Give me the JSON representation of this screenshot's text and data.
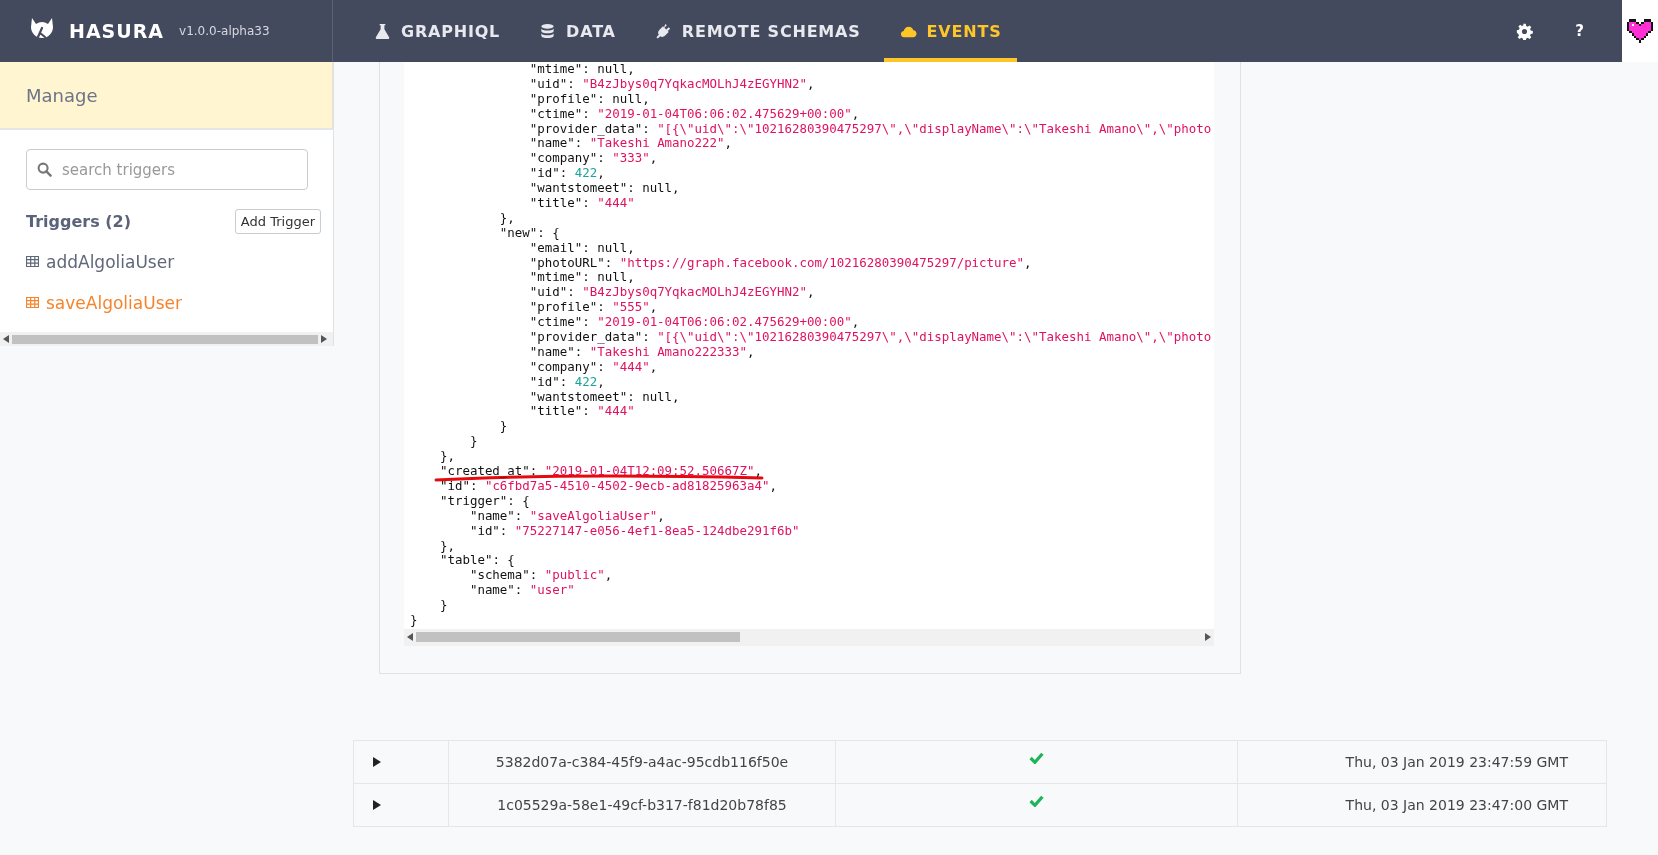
{
  "header": {
    "brand": "HASURA",
    "version": "v1.0.0-alpha33",
    "help": "?"
  },
  "tabs": [
    {
      "label": "GRAPHIQL",
      "kind": "flask",
      "selected": false
    },
    {
      "label": "DATA",
      "kind": "database",
      "selected": false
    },
    {
      "label": "REMOTE SCHEMAS",
      "kind": "plug",
      "selected": false
    },
    {
      "label": "EVENTS",
      "kind": "cloud",
      "selected": true
    }
  ],
  "sidebar": {
    "title": "Manage",
    "search": {
      "placeholder": "search triggers"
    },
    "heading": "Triggers (2)",
    "add_button": "Add Trigger",
    "items": [
      {
        "label": "addAlgoliaUser",
        "selected": false
      },
      {
        "label": "saveAlgoliaUser",
        "selected": true
      }
    ]
  },
  "payload": {
    "lines": [
      {
        "text": "                \"mtime\": null,",
        "underlined": false
      },
      {
        "text": "                \"uid\": \"B4zJbys0q7YqkacMOLhJ4zEGYHN2\",",
        "underlined": false
      },
      {
        "text": "                \"profile\": null,",
        "underlined": false
      },
      {
        "text": "                \"ctime\": \"2019-01-04T06:06:02.475629+00:00\",",
        "underlined": false
      },
      {
        "text": "                \"provider_data\": \"[{\\\"uid\\\":\\\"10216280390475297\\\",\\\"displayName\\\":\\\"Takeshi Amano\\\",\\\"photo",
        "underlined": false
      },
      {
        "text": "                \"name\": \"Takeshi Amano222\",",
        "underlined": false
      },
      {
        "text": "                \"company\": \"333\",",
        "underlined": false
      },
      {
        "text": "                \"id\": 422,",
        "underlined": false
      },
      {
        "text": "                \"wantstomeet\": null,",
        "underlined": false
      },
      {
        "text": "                \"title\": \"444\"",
        "underlined": false
      },
      {
        "text": "            },",
        "underlined": false
      },
      {
        "text": "            \"new\": {",
        "underlined": false
      },
      {
        "text": "                \"email\": null,",
        "underlined": false
      },
      {
        "text": "                \"photoURL\": \"https://graph.facebook.com/10216280390475297/picture\",",
        "underlined": false
      },
      {
        "text": "                \"mtime\": null,",
        "underlined": false
      },
      {
        "text": "                \"uid\": \"B4zJbys0q7YqkacMOLhJ4zEGYHN2\",",
        "underlined": false
      },
      {
        "text": "                \"profile\": \"555\",",
        "underlined": false
      },
      {
        "text": "                \"ctime\": \"2019-01-04T06:06:02.475629+00:00\",",
        "underlined": false
      },
      {
        "text": "                \"provider_data\": \"[{\\\"uid\\\":\\\"10216280390475297\\\",\\\"displayName\\\":\\\"Takeshi Amano\\\",\\\"photo",
        "underlined": false
      },
      {
        "text": "                \"name\": \"Takeshi Amano222333\",",
        "underlined": false
      },
      {
        "text": "                \"company\": \"444\",",
        "underlined": false
      },
      {
        "text": "                \"id\": 422,",
        "underlined": false
      },
      {
        "text": "                \"wantstomeet\": null,",
        "underlined": false
      },
      {
        "text": "                \"title\": \"444\"",
        "underlined": false
      },
      {
        "text": "            }",
        "underlined": false
      },
      {
        "text": "        }",
        "underlined": false
      },
      {
        "text": "    },",
        "underlined": false
      },
      {
        "text": "    \"created_at\": \"2019-01-04T12:09:52.50667Z\",",
        "underlined": true
      },
      {
        "text": "    \"id\": \"c6fbd7a5-4510-4502-9ecb-ad81825963a4\",",
        "underlined": false
      },
      {
        "text": "    \"trigger\": {",
        "underlined": false
      },
      {
        "text": "        \"name\": \"saveAlgoliaUser\",",
        "underlined": false
      },
      {
        "text": "        \"id\": \"75227147-e056-4ef1-8ea5-124dbe291f6b\"",
        "underlined": false
      },
      {
        "text": "    },",
        "underlined": false
      },
      {
        "text": "    \"table\": {",
        "underlined": false
      },
      {
        "text": "        \"schema\": \"public\",",
        "underlined": false
      },
      {
        "text": "        \"name\": \"user\"",
        "underlined": false
      },
      {
        "text": "    }",
        "underlined": false
      },
      {
        "text": "}",
        "underlined": false
      }
    ]
  },
  "events": [
    {
      "id": "5382d07a-c384-45f9-a4ac-95cdb116f50e",
      "expanded": false,
      "success": true,
      "time": "Thu, 03 Jan 2019 23:47:59 GMT"
    },
    {
      "id": "1c05529a-58e1-49cf-b317-f81d20b78f85",
      "expanded": false,
      "success": true,
      "time": "Thu, 03 Jan 2019 23:47:00 GMT"
    }
  ]
}
